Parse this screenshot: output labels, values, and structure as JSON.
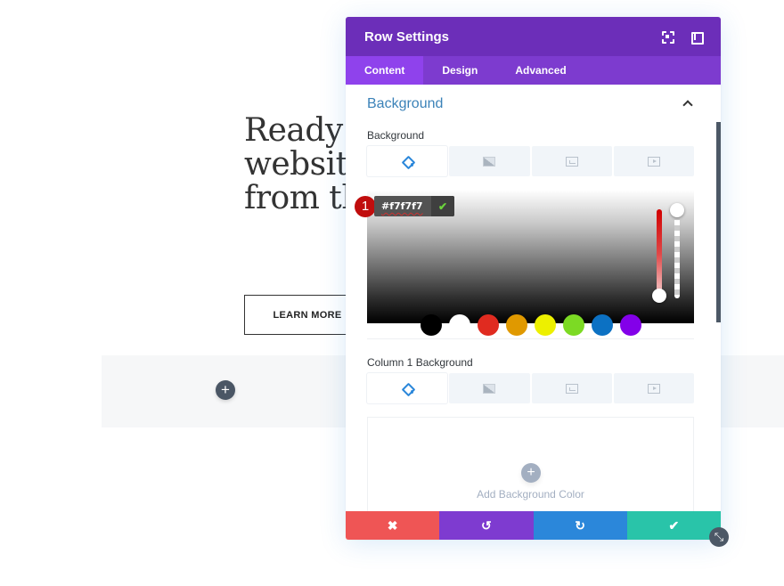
{
  "page": {
    "heading_lines": [
      "Ready t",
      "website",
      "from th"
    ],
    "learn_more_label": "LEARN MORE",
    "add_row_icon": "plus-icon"
  },
  "modal": {
    "title": "Row Settings",
    "header_icons": [
      "expand-icon",
      "split-view-icon"
    ],
    "tabs": [
      {
        "label": "Content",
        "active": true
      },
      {
        "label": "Design",
        "active": false
      },
      {
        "label": "Advanced",
        "active": false
      }
    ],
    "section": {
      "title": "Background",
      "expanded": true
    },
    "background": {
      "label": "Background",
      "type_tabs": [
        "color-icon",
        "gradient-icon",
        "image-icon",
        "video-icon"
      ],
      "active_type": "color",
      "picker": {
        "hex_value": "#f7f7f7",
        "step_badge": "1",
        "hue_level": 0.0,
        "alpha_level": 1.0,
        "swatches": [
          "#000000",
          "#ffffff",
          "#e02b20",
          "#e09900",
          "#edf000",
          "#7cda24",
          "#0c71c3",
          "#8300e9"
        ]
      }
    },
    "column1_background": {
      "label": "Column 1 Background",
      "type_tabs": [
        "color-icon",
        "gradient-icon",
        "image-icon",
        "video-icon"
      ],
      "active_type": "color",
      "add_label": "Add Background Color"
    },
    "footer": {
      "buttons": [
        {
          "name": "cancel",
          "icon": "✖",
          "color": "#ef5555"
        },
        {
          "name": "undo",
          "icon": "↺",
          "color": "#7e3bd0"
        },
        {
          "name": "redo",
          "icon": "↻",
          "color": "#2b87da"
        },
        {
          "name": "save",
          "icon": "✔",
          "color": "#29c4a9"
        }
      ]
    }
  },
  "colors": {
    "header": "#6c2eb9",
    "tabs_bar": "#7d3bcf",
    "tab_active": "#8f42ec",
    "accent_blue": "#2b87da"
  }
}
